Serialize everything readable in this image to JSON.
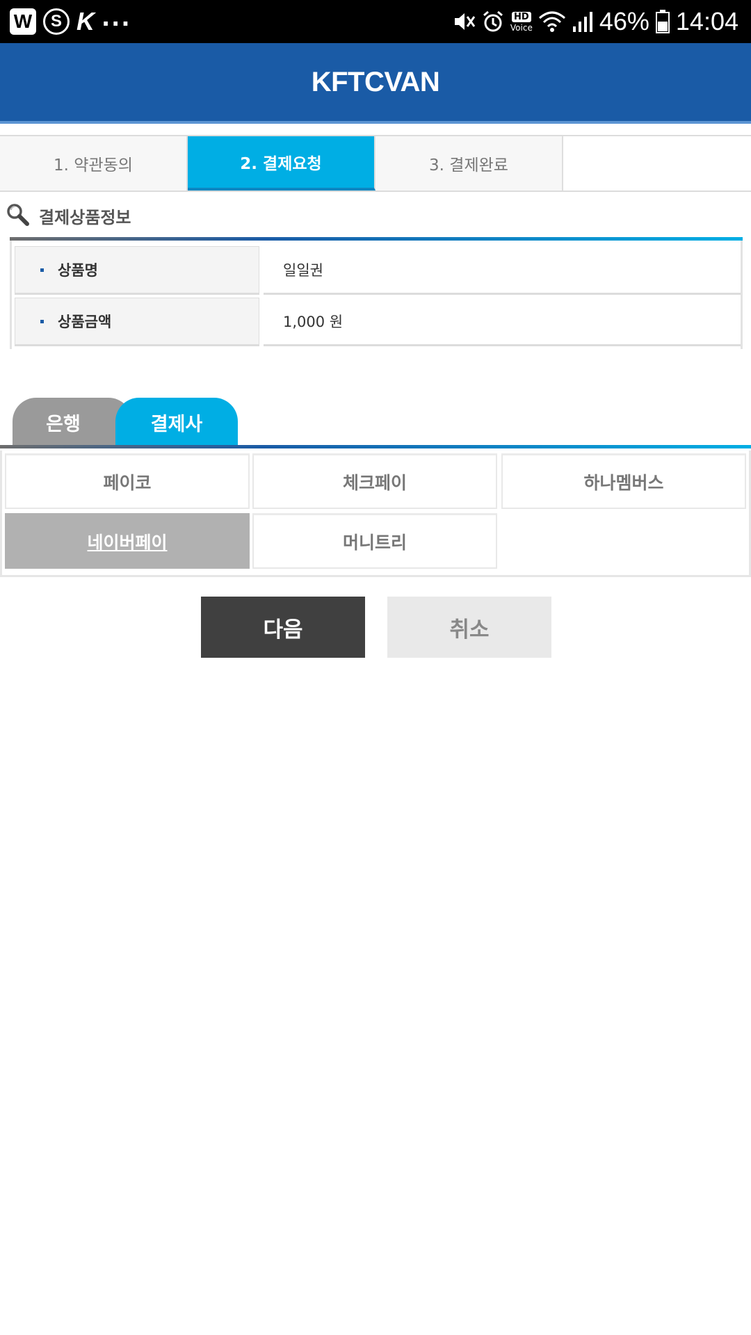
{
  "status_bar": {
    "left_icons": [
      "w-app-icon",
      "s-app-icon",
      "k-app-icon"
    ],
    "overflow": "...",
    "hd_label": "HD",
    "voice_label": "Voice",
    "battery": "46%",
    "time": "14:04"
  },
  "header": {
    "title": "KFTCVAN"
  },
  "steps": [
    {
      "label": "1. 약관동의",
      "active": false
    },
    {
      "label": "2. 결제요청",
      "active": true
    },
    {
      "label": "3. 결제완료",
      "active": false
    }
  ],
  "product_section": {
    "title": "결제상품정보",
    "rows": [
      {
        "label": "상품명",
        "value": "일일권"
      },
      {
        "label": "상품금액",
        "value": "1,000 원"
      }
    ]
  },
  "method_tabs": {
    "bank": "은행",
    "pg": "결제사",
    "active": "pg"
  },
  "providers": {
    "items": [
      "페이코",
      "체크페이",
      "하나멤버스",
      "네이버페이",
      "머니트리"
    ],
    "selected": "네이버페이"
  },
  "buttons": {
    "next": "다음",
    "cancel": "취소"
  },
  "colors": {
    "header_bg": "#1a5ba6",
    "accent": "#00aee4",
    "next_button": "#404040",
    "selected_cell": "#b1b1b1"
  }
}
